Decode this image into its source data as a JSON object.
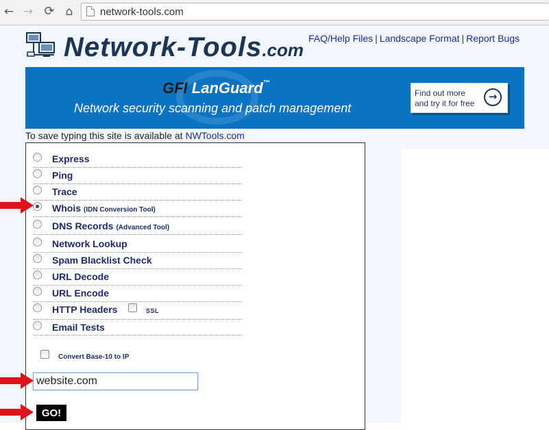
{
  "browser": {
    "back_glyph": "←",
    "forward_glyph": "→",
    "reload_glyph": "⟳",
    "home_glyph": "⌂",
    "url": "network-tools.com"
  },
  "header": {
    "logo_main": "Network-Tools",
    "logo_suffix": ".com",
    "links": [
      "FAQ/Help Files",
      "Landscape Format",
      "Report Bugs"
    ]
  },
  "banner": {
    "brand_gfi": "GFI",
    "brand_name": " LanGuard",
    "brand_mark": "™",
    "tagline": "Network security scanning and patch management",
    "cta_line1": "Find out more",
    "cta_line2": "and try it for free",
    "cta_arrow": "→"
  },
  "notice": {
    "text": "To save typing this site is available at ",
    "link": "NWTools.com"
  },
  "tools": [
    {
      "label": "Express",
      "note": ""
    },
    {
      "label": "Ping",
      "note": ""
    },
    {
      "label": "Trace",
      "note": ""
    },
    {
      "label": "Whois",
      "note": "(IDN Conversion Tool)"
    },
    {
      "label": "DNS Records",
      "note": "(Advanced Tool)"
    },
    {
      "label": "Network Lookup",
      "note": ""
    },
    {
      "label": "Spam Blacklist Check",
      "note": ""
    },
    {
      "label": "URL Decode",
      "note": ""
    },
    {
      "label": "URL Encode",
      "note": ""
    },
    {
      "label": "HTTP Headers",
      "note": ""
    },
    {
      "label": "Email Tests",
      "note": ""
    }
  ],
  "selected_tool": "Whois",
  "ssl_label": "SSL",
  "convert_label": "Convert Base-10 to IP",
  "host_input": {
    "value": "website.com"
  },
  "go_label": "GO!",
  "colors": {
    "annotation_arrow": "#e0121a",
    "banner_blue": "#0a73c4",
    "logo_navy": "#1c3557",
    "link_blue": "#1a2a9a"
  }
}
